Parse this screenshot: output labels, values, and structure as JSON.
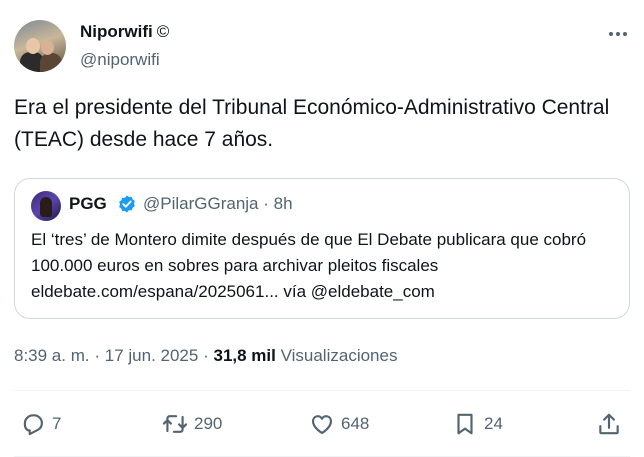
{
  "author": {
    "name": "Niporwifi",
    "mark": "©",
    "handle": "@niporwifi"
  },
  "tweet": {
    "text": "Era el presidente del Tribunal Económico-Administrativo Central (TEAC) desde hace 7 años."
  },
  "quote": {
    "name": "PGG",
    "verified": true,
    "handle": "@PilarGGranja",
    "time": "· 8h",
    "text": "El ‘tres’ de Montero dimite después de que El Debate publicara que cobró 100.000 euros en sobres para archivar pleitos fiscales eldebate.com/espana/2025061... vía @eldebate_com"
  },
  "meta": {
    "time": "8:39 a. m.",
    "separator1": "·",
    "date": "17 jun. 2025",
    "separator2": "·",
    "views_count": "31,8 mil",
    "views_label": "Visualizaciones"
  },
  "actions": {
    "replies": "7",
    "reposts": "290",
    "likes": "648",
    "bookmarks": "24"
  },
  "colors": {
    "text": "#0f1419",
    "secondary": "#536471",
    "border": "#cfd9de",
    "verified": "#1d9bf0"
  },
  "icons": [
    "more-icon",
    "verified-badge-icon",
    "reply-icon",
    "repost-icon",
    "like-icon",
    "bookmark-icon",
    "share-icon"
  ]
}
